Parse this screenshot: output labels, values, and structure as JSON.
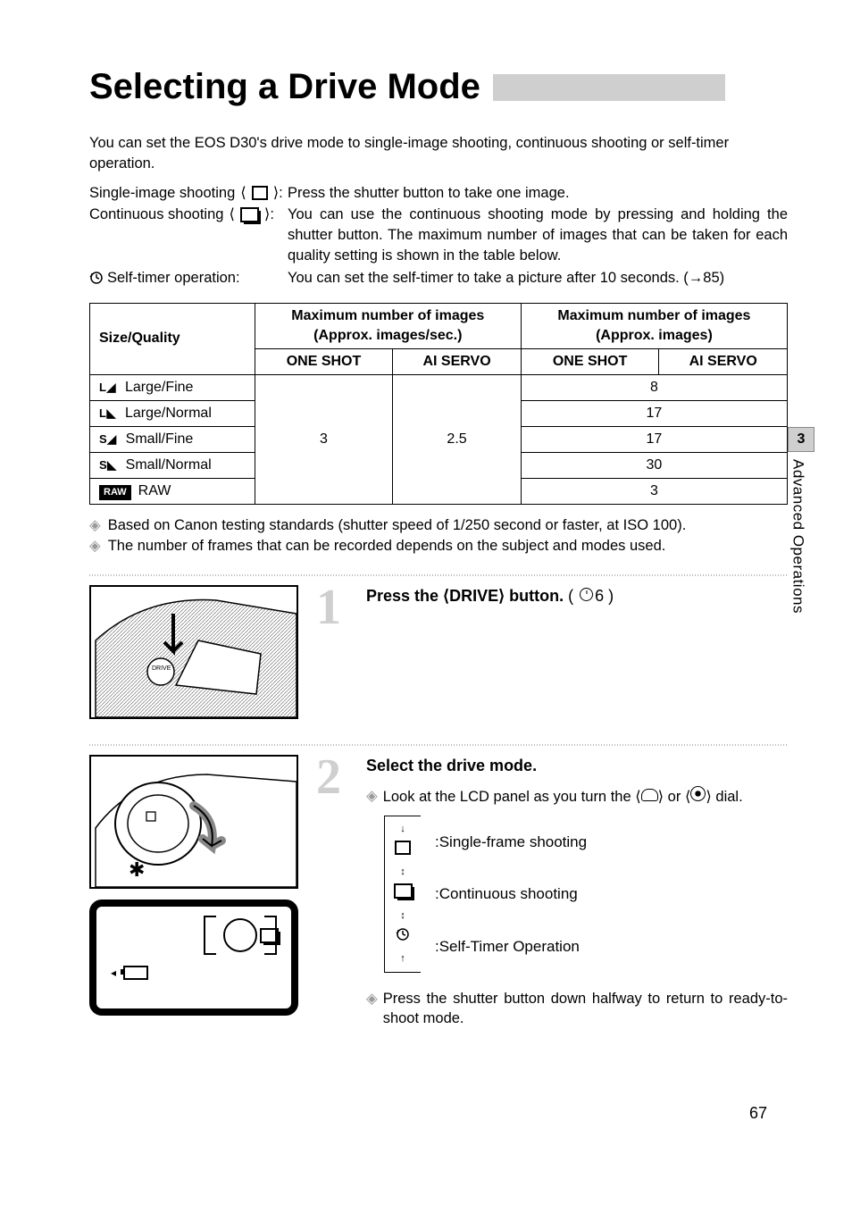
{
  "sidebar": {
    "chapter": "3",
    "label": "Advanced Operations"
  },
  "title": "Selecting a Drive Mode",
  "intro": "You can set the EOS D30's drive mode to single-image shooting, continuous shooting or self-timer operation.",
  "modes": {
    "single": {
      "label": "Single-image shooting",
      "desc": "Press the shutter button to take one image."
    },
    "cont": {
      "label": "Continuous shooting",
      "desc": "You can use the continuous shooting mode by pressing and holding the shutter button. The maximum number of images that can be taken for each quality setting is shown in the table below."
    },
    "timer": {
      "label": "Self-timer operation:",
      "desc": "You can set the self-timer to take a picture after 10 seconds. (→85)"
    }
  },
  "table": {
    "h_size": "Size/Quality",
    "h_max_sec": "Maximum number of images\n(Approx. images/sec.)",
    "h_max_img": "Maximum number of images\n(Approx. images)",
    "sub_one": "ONE SHOT",
    "sub_ai": "AI SERVO",
    "rows": [
      {
        "icon": "L◢",
        "label": "Large/Fine",
        "max": "8"
      },
      {
        "icon": "L◣",
        "label": "Large/Normal",
        "max": "17"
      },
      {
        "icon": "S◢",
        "label": "Small/Fine",
        "max": "17"
      },
      {
        "icon": "S◣",
        "label": "Small/Normal",
        "max": "30"
      },
      {
        "icon": "RAW",
        "label": "RAW",
        "max": "3"
      }
    ],
    "one_shot_fps": "3",
    "ai_servo_fps": "2.5"
  },
  "notes": [
    "Based on Canon testing standards (shutter speed of 1/250 second or faster, at ISO 100).",
    "The number of frames that can be recorded depends on the subject and modes used."
  ],
  "step1": {
    "num": "1",
    "heading_pre": "Press the ",
    "heading_b": "⟨DRIVE⟩",
    "heading_post": " button.",
    "timeout": "6"
  },
  "step2": {
    "num": "2",
    "heading": "Select the drive mode.",
    "look": "Look at the LCD panel as you turn the ",
    "look2": " or ",
    "look3": " dial.",
    "opt1": ":Single-frame shooting",
    "opt2": ":Continuous shooting",
    "opt3": ":Self-Timer Operation",
    "ret": "Press the shutter button down halfway to return to ready-to-shoot mode."
  },
  "pagenum": "67"
}
